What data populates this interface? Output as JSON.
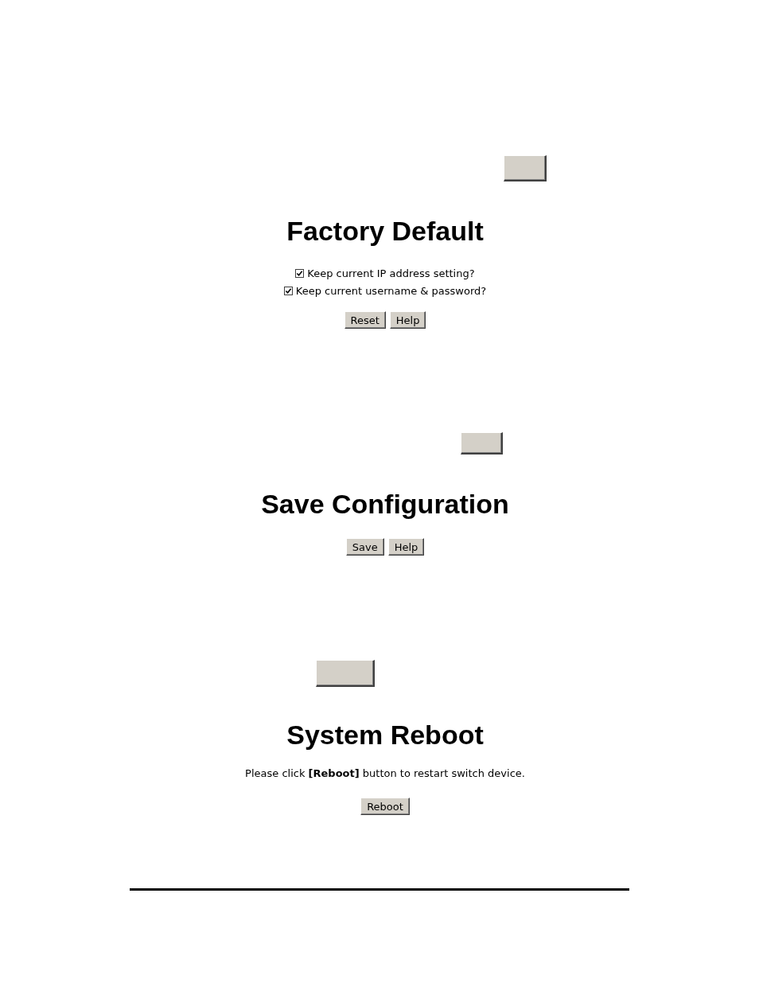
{
  "sections": [
    {
      "blank_button": true,
      "title": "Factory Default",
      "options": [
        {
          "label": "Keep current IP address setting?",
          "checked": true
        },
        {
          "label": "Keep current username & password?",
          "checked": true
        }
      ],
      "buttons": [
        "Reset",
        "Help"
      ]
    },
    {
      "blank_button": true,
      "title": "Save Configuration",
      "buttons": [
        "Save",
        "Help"
      ]
    },
    {
      "blank_button": true,
      "title": "System Reboot",
      "message": "Please click **[Reboot]** button to restart switch device.",
      "buttons": [
        "Reboot"
      ]
    }
  ]
}
